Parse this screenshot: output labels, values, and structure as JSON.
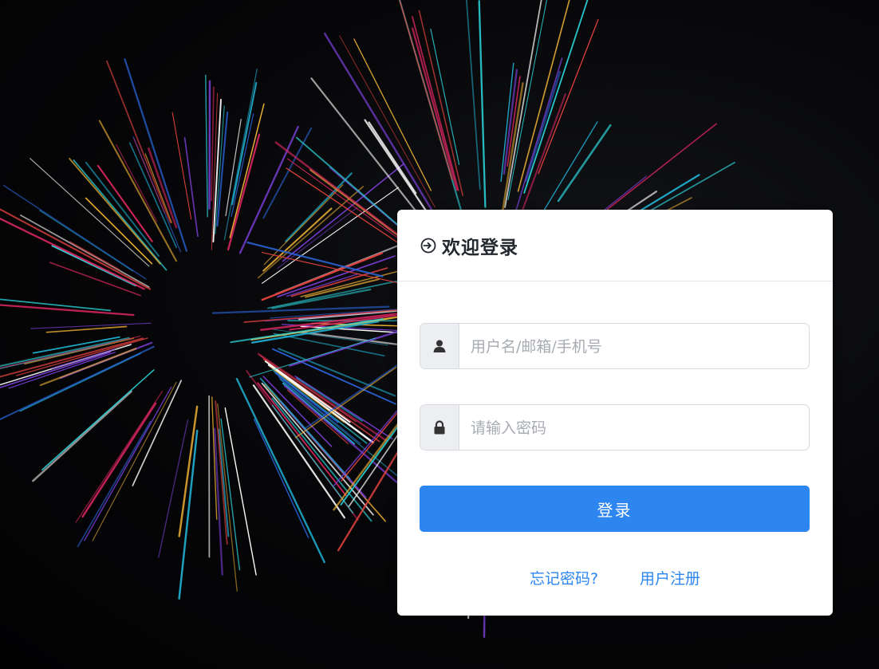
{
  "colors": {
    "background": "#050507",
    "card": "#ffffff",
    "primary": "#2d86f0",
    "title": "#24292f",
    "placeholder": "#a7abb2",
    "addon_bg": "#eceef1"
  },
  "header": {
    "icon": "login-arrow-icon",
    "title": "欢迎登录"
  },
  "form": {
    "username": {
      "icon": "user-icon",
      "value": "",
      "placeholder": "用户名/邮箱/手机号"
    },
    "password": {
      "icon": "lock-icon",
      "value": "",
      "placeholder": "请输入密码"
    },
    "submit_label": "登录"
  },
  "links": {
    "forgot_password": "忘记密码?",
    "register": "用户注册"
  },
  "background": {
    "description_icon": "fireworks-background"
  }
}
